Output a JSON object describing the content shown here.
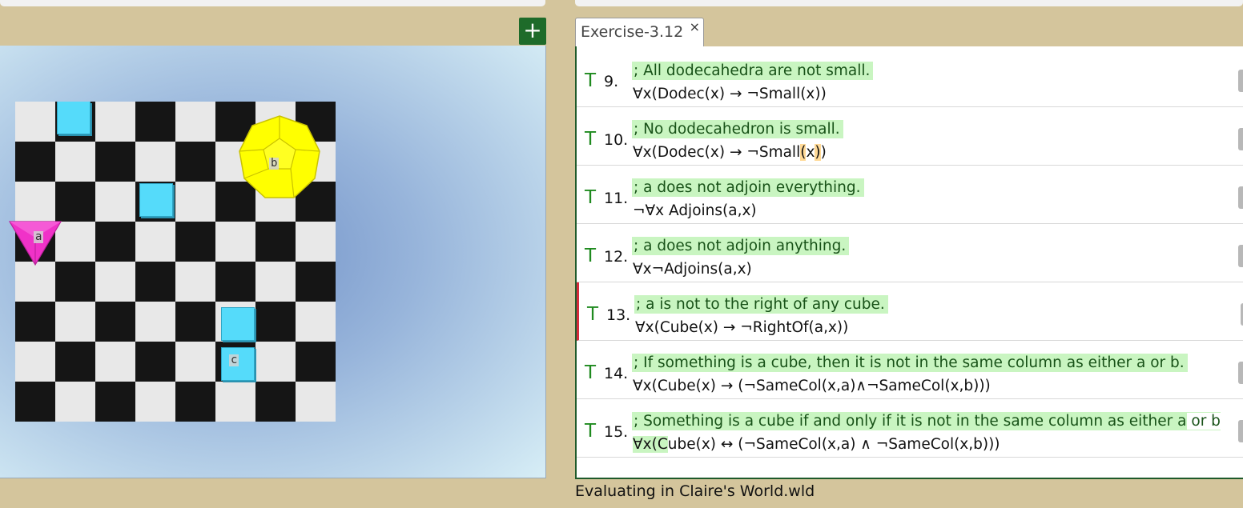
{
  "world": {
    "add_button_label": "+",
    "shapes": [
      {
        "type": "cube",
        "label": ""
      },
      {
        "type": "cube",
        "label": ""
      },
      {
        "type": "cube",
        "label": ""
      },
      {
        "type": "cube",
        "label": "c"
      },
      {
        "type": "dodecahedron",
        "label": "b"
      },
      {
        "type": "tetrahedron",
        "label": "a"
      }
    ],
    "colors": {
      "cube": "#55dbfa",
      "dodecahedron": "#ffff00",
      "tetrahedron": "#f032c8",
      "board_light": "#e8e8e8",
      "board_dark": "#151515"
    }
  },
  "tab": {
    "title": "Exercise-3.12",
    "close_icon": "×"
  },
  "sentences": [
    {
      "truth": "T",
      "number": "9.",
      "comment": "; All dodecahedra are not small.",
      "formula": "∀x(Dodec(x) → ¬Small(x))"
    },
    {
      "truth": "T",
      "number": "10.",
      "comment": "; No dodecahedron is small.",
      "formula_parts": [
        "∀x(Dodec(x) → ¬Small",
        "(",
        "x",
        ")",
        ")"
      ]
    },
    {
      "truth": "T",
      "number": "11.",
      "comment": "; a does not adjoin everything.",
      "formula": "¬∀x Adjoins(a,x)"
    },
    {
      "truth": "T",
      "number": "12.",
      "comment": "; a does not adjoin anything.",
      "formula": "∀x¬Adjoins(a,x)"
    },
    {
      "truth": "T",
      "number": "13.",
      "comment": "; a is not to the right of any cube.",
      "formula": "∀x(Cube(x) → ¬RightOf(a,x))"
    },
    {
      "truth": "T",
      "number": "14.",
      "comment": "; If something is a cube, then it is not in the same column as either a or b.",
      "formula": "∀x(Cube(x) → (¬SameCol(x,a)∧¬SameCol(x,b)))"
    },
    {
      "truth": "T",
      "number": "15.",
      "comment": "; Something is a cube if and only if it is not in the same column as either a",
      "comment_tail": " or b",
      "formula_head": "∀x(C",
      "formula_tail": "ube(x) ↔ (¬SameCol(x,a) ∧ ¬SameCol(x,b)))"
    }
  ],
  "status": "Evaluating in Claire's World.wld"
}
